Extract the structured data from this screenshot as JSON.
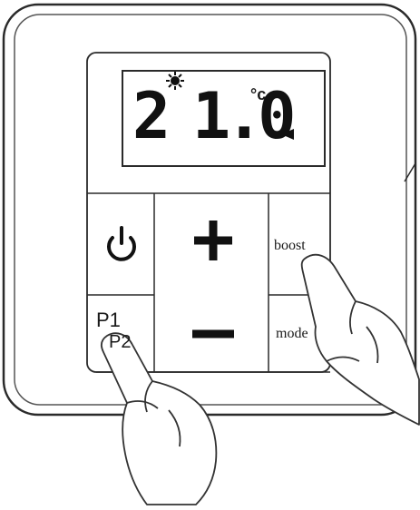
{
  "display": {
    "digit_left": "2",
    "digit_right": "1.0",
    "unit": "°c"
  },
  "buttons": {
    "power_icon": "power-icon",
    "plus_label": "+",
    "minus_label": "−",
    "boost_label": "boost",
    "mode_label": "mode",
    "p1_label": "P1",
    "p2_label": "P2"
  }
}
